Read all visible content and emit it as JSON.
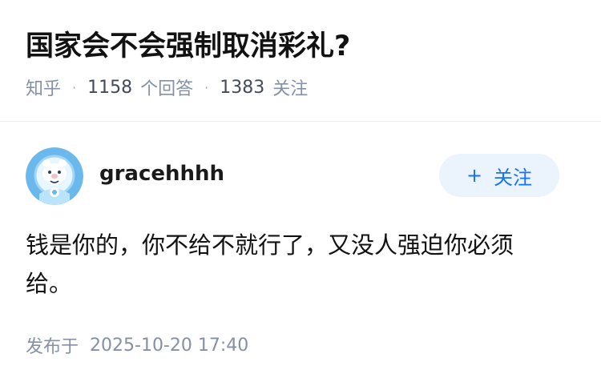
{
  "question": {
    "title": "国家会不会强制取消彩礼?",
    "source": "知乎",
    "separator": "·",
    "answer_count": "1158",
    "answer_label": "个回答",
    "follower_count": "1383",
    "follower_label": "关注"
  },
  "answer": {
    "author": {
      "name": "gracehhhh",
      "avatar_icon": "astronaut-bear-avatar"
    },
    "follow_button": {
      "icon": "plus-icon",
      "plus": "+",
      "label": "关注"
    },
    "content": "钱是你的，你不给不就行了，又没人强迫你必须给。",
    "publish_label": "发布于",
    "publish_time": "2025-10-20 17:40"
  },
  "colors": {
    "accent": "#1772f6",
    "follow_bg": "#ebf3fd",
    "meta_text": "#8590a6",
    "title_text": "#121212"
  }
}
